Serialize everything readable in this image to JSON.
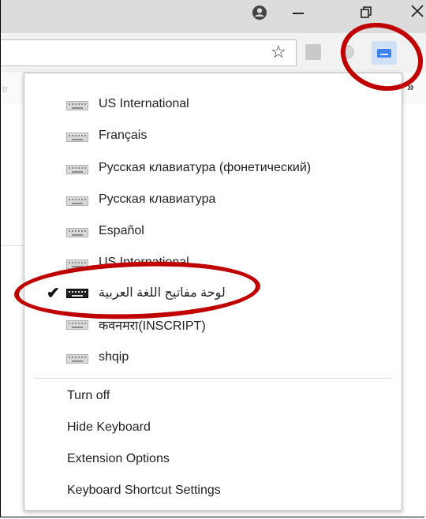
{
  "toolbar": {
    "star_icon": "☆"
  },
  "bookmarks": {
    "overflow_chevron": "»",
    "faint_text": "tr"
  },
  "menu": {
    "layouts": [
      {
        "label": "US International",
        "selected": false
      },
      {
        "label": "Français",
        "selected": false
      },
      {
        "label": "Русская клавиатура (фонетический)",
        "selected": false
      },
      {
        "label": "Русская клавиатура",
        "selected": false
      },
      {
        "label": "Español",
        "selected": false
      },
      {
        "label": "US International",
        "selected": false
      },
      {
        "label": "لوحة مفاتيح اللغة العربية",
        "selected": true
      },
      {
        "label": "कवनमरा(INSCRIPT)",
        "selected": false
      },
      {
        "label": "shqip",
        "selected": false
      }
    ],
    "check_mark": "✔",
    "commands": [
      {
        "label": "Turn off"
      },
      {
        "label": "Hide Keyboard"
      },
      {
        "label": "Extension Options"
      },
      {
        "label": "Keyboard Shortcut Settings"
      }
    ]
  },
  "icons": {
    "avatar": "account-circle-icon",
    "keyboard_layout": "keyboard-icon",
    "extension": "virtual-keyboard-extension-icon"
  },
  "colors": {
    "annotation_red": "#c00000",
    "extension_blue": "#3b82f0"
  }
}
